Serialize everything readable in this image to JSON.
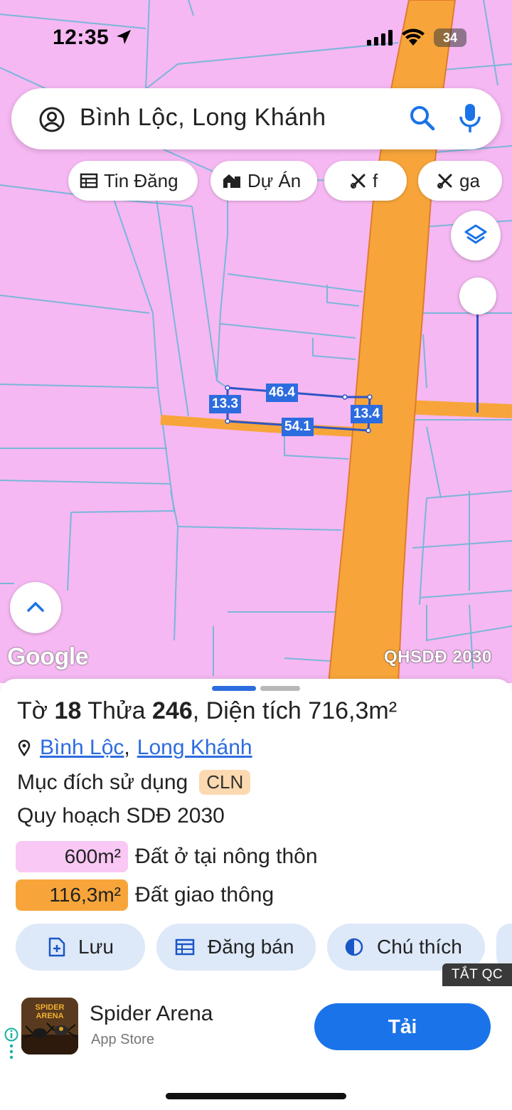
{
  "status_bar": {
    "time": "12:35",
    "battery": "34"
  },
  "search": {
    "query": "Bình Lộc, Long Khánh"
  },
  "chips": [
    {
      "label": "Tin Đăng",
      "icon": "table-icon"
    },
    {
      "label": "Dự Án",
      "icon": "building-icon"
    },
    {
      "label": "f",
      "icon": "tools-icon"
    },
    {
      "label": "ga",
      "icon": "tools-icon"
    }
  ],
  "map": {
    "google_logo": "Google",
    "layer_label": "QHSDĐ 2030",
    "measurements": {
      "top": "46.4",
      "left": "13.3",
      "right": "13.4",
      "bottom": "54.1"
    },
    "colors": {
      "residential": "#f5b8f2",
      "road": "#f7a53a",
      "parcel_lines": "#7ab6d9"
    }
  },
  "sheet": {
    "parcel": {
      "sheet_label": "Tờ",
      "sheet_no": "18",
      "plot_label": "Thửa",
      "plot_no": "246",
      "area_label": "Diện tích",
      "area": "716,3m²"
    },
    "address": {
      "ward": "Bình Lộc",
      "separator": ",",
      "city": "Long Khánh"
    },
    "purpose": {
      "label": "Mục đích sử dụng",
      "code": "CLN"
    },
    "plan_title": "Quy hoạch SDĐ 2030",
    "zones": [
      {
        "area": "600m²",
        "label": "Đất ở tại nông thôn",
        "color": "#f9c8f4"
      },
      {
        "area": "116,3m²",
        "label": "Đất giao thông",
        "color": "#f7a53a"
      }
    ],
    "actions": [
      {
        "label": "Lưu",
        "icon": "add-file-icon"
      },
      {
        "label": "Đăng bán",
        "icon": "table-icon"
      },
      {
        "label": "Chú thích",
        "icon": "contrast-icon"
      }
    ],
    "ad_close": "TẮT QC"
  },
  "ad": {
    "app_name": "Spider Arena",
    "store": "App Store",
    "cta": "Tải",
    "icon_text": "SPIDER ARENA"
  }
}
